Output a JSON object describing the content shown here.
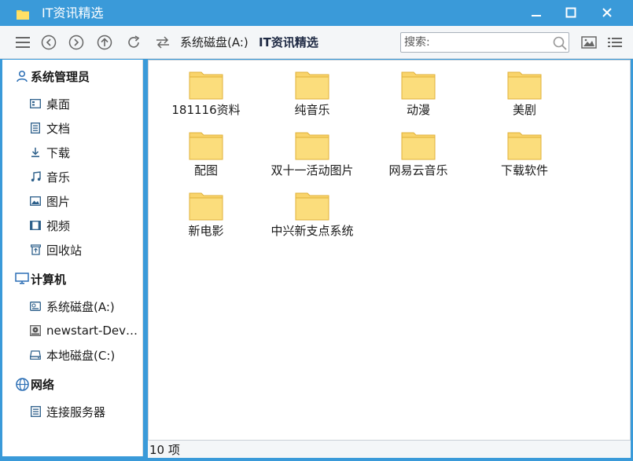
{
  "window": {
    "title": "IT资讯精选"
  },
  "toolbar": {
    "path_parent": "系统磁盘(A:)",
    "path_current": "IT资讯精选",
    "search_placeholder": "搜索:"
  },
  "sidebar": {
    "groups": [
      {
        "label": "系统管理员",
        "icon": "user-icon",
        "items": [
          {
            "label": "桌面",
            "icon": "desktop-icon"
          },
          {
            "label": "文档",
            "icon": "document-icon"
          },
          {
            "label": "下载",
            "icon": "download-icon"
          },
          {
            "label": "音乐",
            "icon": "music-icon"
          },
          {
            "label": "图片",
            "icon": "picture-icon"
          },
          {
            "label": "视频",
            "icon": "video-icon"
          },
          {
            "label": "回收站",
            "icon": "trash-icon"
          }
        ]
      },
      {
        "label": "计算机",
        "icon": "computer-icon",
        "items": [
          {
            "label": "系统磁盘(A:)",
            "icon": "os-disk-icon"
          },
          {
            "label": "newstart-Dev…",
            "icon": "optical-disc-icon"
          },
          {
            "label": "本地磁盘(C:)",
            "icon": "hard-disk-icon"
          }
        ]
      },
      {
        "label": "网络",
        "icon": "network-icon",
        "items": [
          {
            "label": "连接服务器",
            "icon": "server-icon"
          }
        ]
      }
    ]
  },
  "folders": [
    {
      "name": "181116资料"
    },
    {
      "name": "纯音乐"
    },
    {
      "name": "动漫"
    },
    {
      "name": "美剧"
    },
    {
      "name": "配图"
    },
    {
      "name": "双十一活动图片"
    },
    {
      "name": "网易云音乐"
    },
    {
      "name": "下载软件"
    },
    {
      "name": "新电影"
    },
    {
      "name": "中兴新支点系统"
    }
  ],
  "status": {
    "item_count": "10 项"
  },
  "colors": {
    "titlebar": "#3a9ad9",
    "folder_fill": "#fbd96a",
    "folder_stroke": "#e3b53c"
  }
}
